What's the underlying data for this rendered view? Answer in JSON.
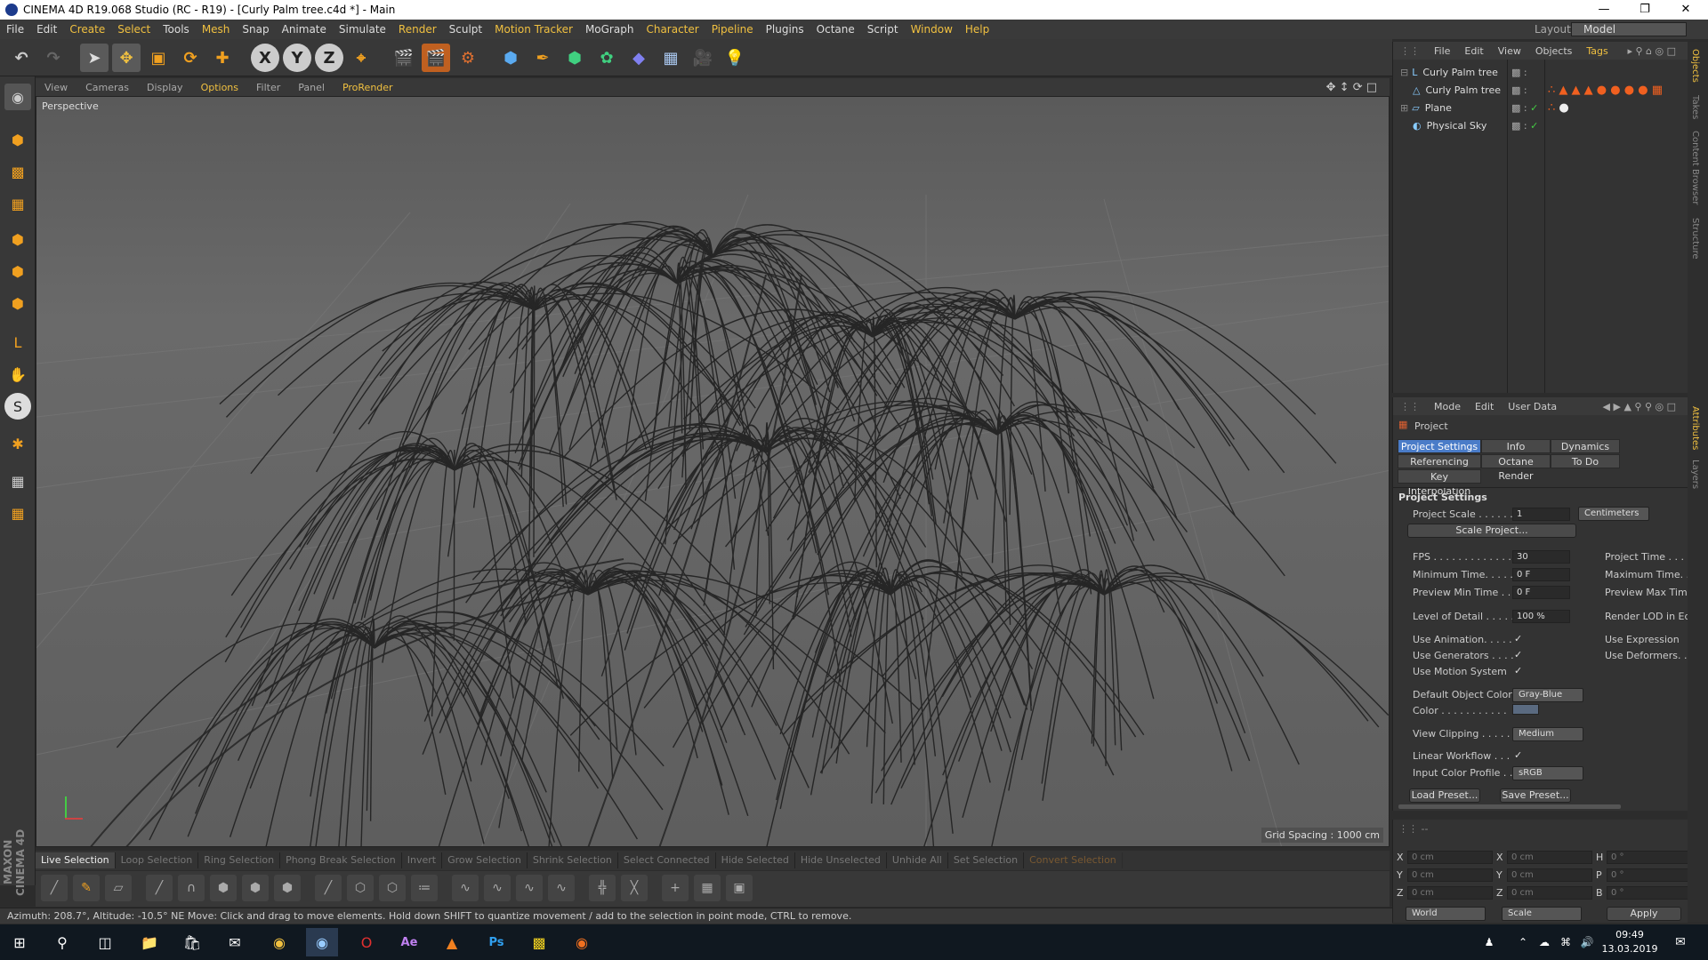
{
  "window": {
    "title": "CINEMA 4D R19.068 Studio (RC - R19) - [Curly Palm tree.c4d *] - Main",
    "layout_label": "Layout:",
    "layout_value": "Model"
  },
  "menu": [
    "File",
    "Edit",
    "Create",
    "Select",
    "Tools",
    "Mesh",
    "Snap",
    "Animate",
    "Simulate",
    "Render",
    "Sculpt",
    "Motion Tracker",
    "MoGraph",
    "Character",
    "Pipeline",
    "Plugins",
    "Octane",
    "Script",
    "Window",
    "Help"
  ],
  "viewport": {
    "menu": [
      "View",
      "Cameras",
      "Display",
      "Options",
      "Filter",
      "Panel",
      "ProRender"
    ],
    "label": "Perspective",
    "grid_spacing": "Grid Spacing : 1000 cm"
  },
  "selection_bar": [
    "Live Selection",
    "Loop Selection",
    "Ring Selection",
    "Phong Break Selection",
    "Invert",
    "Grow Selection",
    "Shrink Selection",
    "Select Connected",
    "Hide Selected",
    "Hide Unselected",
    "Unhide All",
    "Set Selection",
    "Convert Selection"
  ],
  "status": "Azimuth: 208.7°, Altitude: -10.5°  NE     Move: Click and drag to move elements. Hold down SHIFT to quantize movement / add to the selection in point mode, CTRL to remove.",
  "logo_text": "MAXON CINEMA 4D",
  "objects": {
    "menu": [
      "File",
      "Edit",
      "View",
      "Objects",
      "Tags"
    ],
    "items": [
      "Curly Palm tree",
      "Curly Palm tree",
      "Plane",
      "Physical Sky"
    ]
  },
  "attributes": {
    "menu": [
      "Mode",
      "Edit",
      "User Data"
    ],
    "header": "Project",
    "tabs": [
      "Project Settings",
      "Info",
      "Dynamics",
      "Referencing",
      "Octane Render",
      "To Do",
      "Key Interpolation"
    ],
    "section": "Project Settings",
    "project_scale_label": "Project Scale . . . . . .",
    "project_scale_value": "1",
    "project_scale_unit": "Centimeters",
    "scale_project_btn": "Scale Project...",
    "fps_label": "FPS . . . . . . . . . . . . . .",
    "fps_value": "30",
    "project_time_label": "Project Time . . . . .",
    "min_time_label": "Minimum Time. . . . .",
    "min_time_value": "0 F",
    "max_time_label": "Maximum Time. . .",
    "preview_min_label": "Preview Min Time . .",
    "preview_min_value": "0 F",
    "preview_max_label": "Preview Max Time",
    "lod_label": "Level of Detail . . . . .",
    "lod_value": "100 %",
    "render_lod_label": "Render LOD in Ed",
    "use_animation": "Use Animation. . . . .",
    "use_expression": "Use Expression",
    "use_generators": "Use Generators . . . .",
    "use_deformers": "Use Deformers. . .",
    "use_motion": "Use Motion System",
    "default_color_label": "Default Object Color",
    "default_color_value": "Gray-Blue",
    "color_label": "Color . . . . . . . . . . .",
    "view_clipping_label": "View Clipping . . . . .",
    "view_clipping_value": "Medium",
    "linear_workflow": "Linear Workflow . . .",
    "input_profile_label": "Input Color Profile . .",
    "input_profile_value": "sRGB",
    "load_preset": "Load Preset...",
    "save_preset": "Save Preset..."
  },
  "coords": {
    "rows": [
      {
        "a": "X",
        "av": "0 cm",
        "b": "X",
        "bv": "0 cm",
        "c": "H",
        "cv": "0 °"
      },
      {
        "a": "Y",
        "av": "0 cm",
        "b": "Y",
        "bv": "0 cm",
        "c": "P",
        "cv": "0 °"
      },
      {
        "a": "Z",
        "av": "0 cm",
        "b": "Z",
        "bv": "0 cm",
        "c": "B",
        "cv": "0 °"
      }
    ],
    "world": "World",
    "scale": "Scale",
    "apply": "Apply"
  },
  "side_tabs": [
    "Objects",
    "Takes",
    "Content Browser",
    "Structure",
    "Attributes",
    "Layers"
  ],
  "taskbar": {
    "time": "09:49",
    "date": "13.03.2019"
  }
}
